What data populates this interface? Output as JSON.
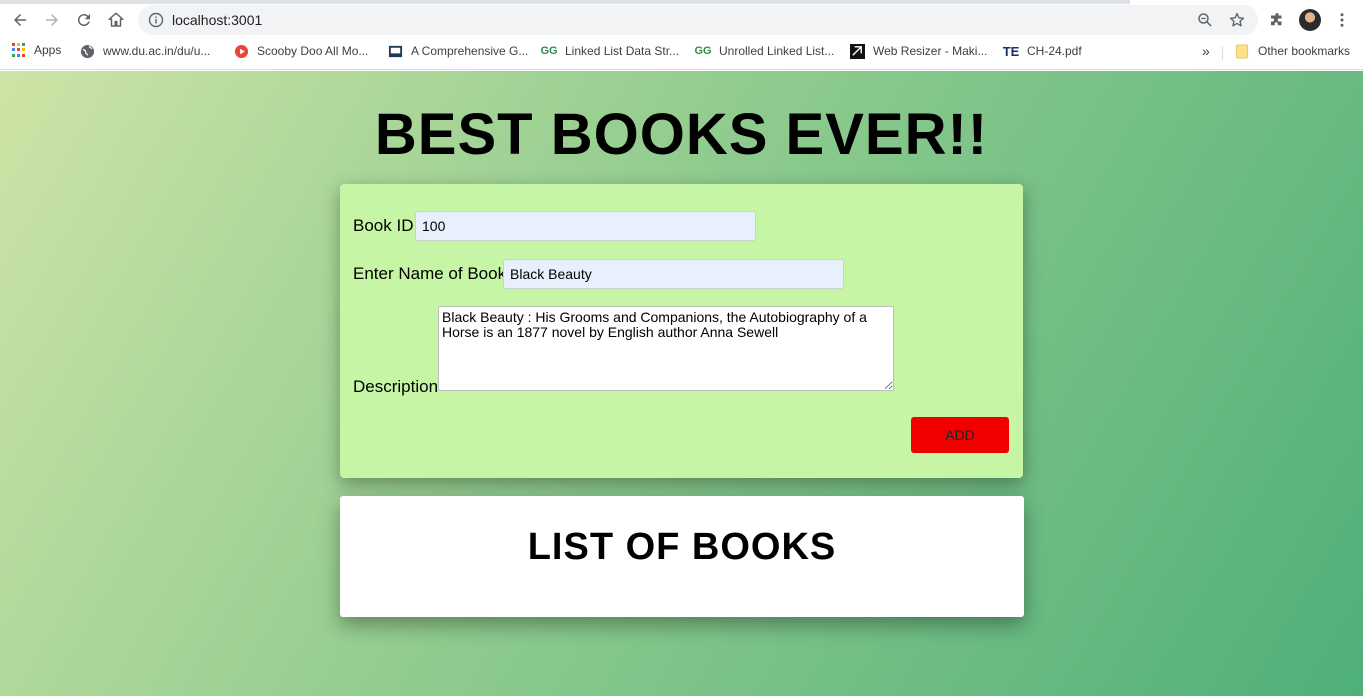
{
  "browser": {
    "url": "localhost:3001",
    "bookmarks": [
      {
        "label": "Apps",
        "icon": "apps-grid-icon"
      },
      {
        "label": "www.du.ac.in/du/u...",
        "icon": "globe-icon"
      },
      {
        "label": "Scooby Doo All Mo...",
        "icon": "play-icon"
      },
      {
        "label": "A Comprehensive G...",
        "icon": "monitor-icon"
      },
      {
        "label": "Linked List Data Str...",
        "icon": "gfg-icon"
      },
      {
        "label": "Unrolled Linked List...",
        "icon": "gfg-icon"
      },
      {
        "label": "Web Resizer - Maki...",
        "icon": "resizer-icon"
      },
      {
        "label": "CH-24.pdf",
        "icon": "te-icon"
      }
    ],
    "overflow": "»",
    "other_bookmarks": "Other bookmarks"
  },
  "page": {
    "title": "BEST BOOKS EVER!!",
    "form": {
      "book_id_label": "Book ID",
      "book_id_value": "100",
      "name_label": "Enter Name of Book",
      "name_value": "Black Beauty",
      "description_label": "Description",
      "description_value": "Black Beauty : His Grooms and Companions, the Autobiography of a Horse is an 1877 novel by English author Anna Sewell",
      "add_label": "ADD"
    },
    "list_title": "LIST OF BOOKS"
  },
  "colors": {
    "form_bg": "#c5f5a5",
    "add_button": "#f20000",
    "input_bg": "#e8f0fe"
  }
}
